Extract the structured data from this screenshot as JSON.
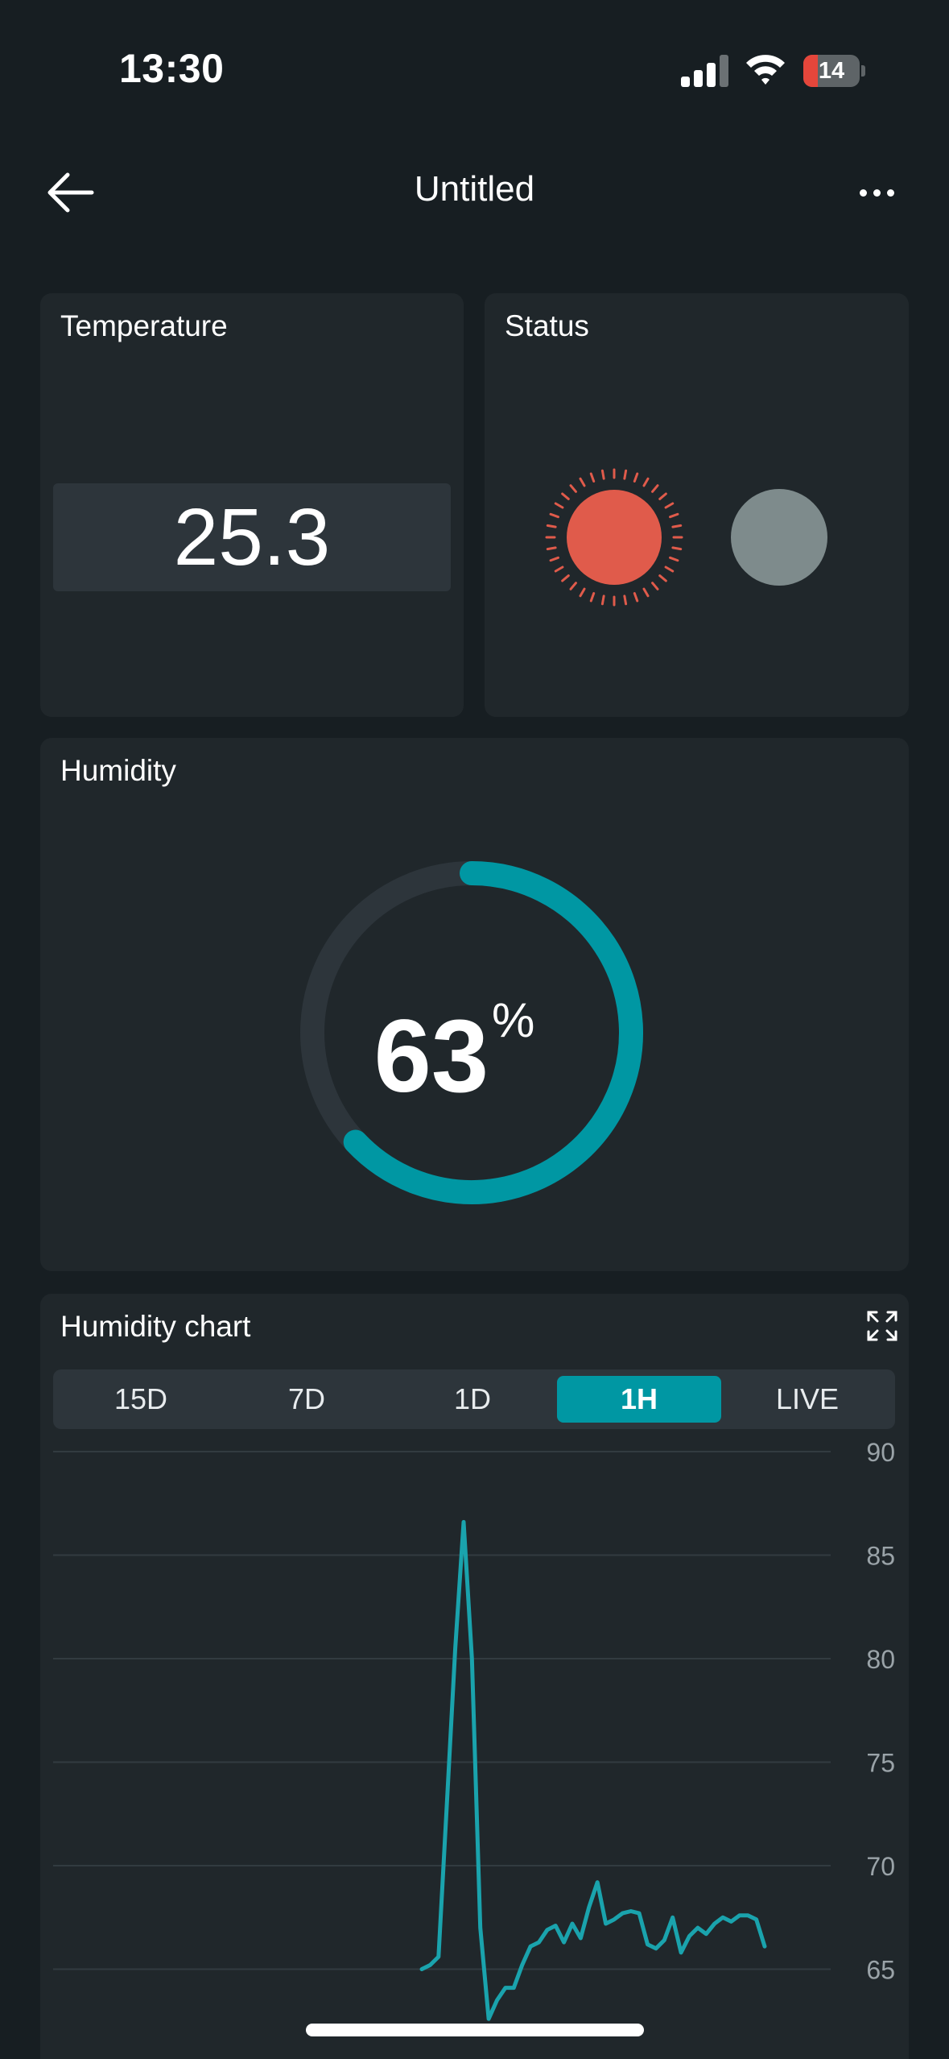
{
  "status_bar": {
    "time": "13:30",
    "battery_level": "14",
    "battery_fraction": 0.14,
    "battery_color": "#e5463b",
    "icons": [
      "cellular-signal-icon",
      "wifi-icon",
      "battery-icon"
    ]
  },
  "header": {
    "title": "Untitled",
    "back_icon": "arrow-left-icon",
    "more_icon": "more-horizontal-icon"
  },
  "temperature": {
    "title": "Temperature",
    "value": "25.3"
  },
  "status": {
    "title": "Status",
    "leds": [
      {
        "name": "status-led-active",
        "color": "#e05b4b",
        "glowing": true
      },
      {
        "name": "status-led-inactive",
        "color": "#7e8b8c",
        "glowing": false
      }
    ]
  },
  "humidity": {
    "title": "Humidity",
    "value": "63",
    "unit": "%",
    "fraction": 0.63,
    "accent": "#0097a3",
    "track": "#2d353b"
  },
  "humidity_chart": {
    "title": "Humidity chart",
    "expand_icon": "expand-icon",
    "ranges": [
      "15D",
      "7D",
      "1D",
      "1H",
      "LIVE"
    ],
    "active_range": "1H"
  },
  "chart_data": {
    "type": "line",
    "title": "Humidity chart",
    "xlabel": "",
    "ylabel": "",
    "ylim": [
      62,
      90
    ],
    "y_ticks": [
      "90",
      "85",
      "80",
      "75",
      "70",
      "65"
    ],
    "grid": true,
    "legend": "none",
    "series": [
      {
        "color": "#1aa3ad",
        "x": [
          0,
          1,
          2,
          3,
          4,
          5,
          6,
          7,
          8,
          9,
          10,
          11,
          12,
          13,
          14,
          15,
          16,
          17,
          18,
          19,
          20,
          21,
          22,
          23,
          24,
          25,
          26,
          27,
          28,
          29,
          30,
          31,
          32,
          33,
          34,
          35,
          36,
          37,
          38,
          39,
          40,
          41
        ],
        "values": [
          65,
          65.2,
          65.6,
          73,
          80.5,
          86.6,
          80,
          67,
          62.6,
          63.5,
          64.1,
          64.1,
          65.2,
          66.1,
          66.3,
          66.9,
          67.1,
          66.3,
          67.2,
          66.5,
          68,
          69.2,
          67.2,
          67.4,
          67.7,
          67.8,
          67.7,
          66.2,
          66,
          66.4,
          67.5,
          65.8,
          66.6,
          67,
          66.7,
          67.2,
          67.5,
          67.3,
          67.6,
          67.6,
          67.4,
          66.1
        ]
      }
    ]
  }
}
